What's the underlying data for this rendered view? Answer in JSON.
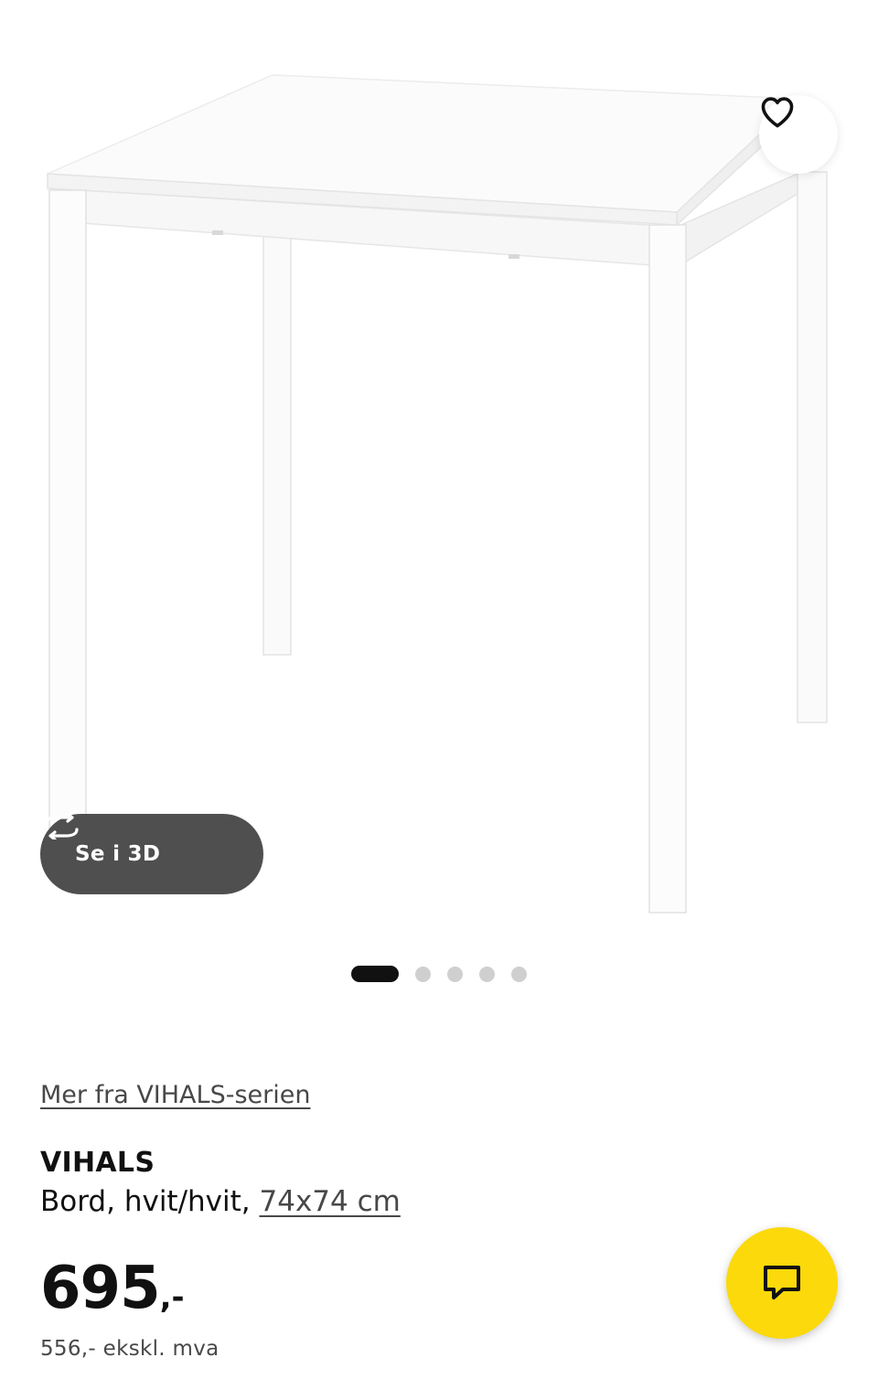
{
  "product_image": {
    "alt_name": "table-product-image"
  },
  "favorite": {
    "icon": "heart-icon"
  },
  "view_3d": {
    "label": "Se i 3D",
    "icon": "rotate-3d-icon"
  },
  "carousel": {
    "total": 5,
    "active_index": 0
  },
  "series_link": {
    "label": "Mer fra VIHALS-serien"
  },
  "product": {
    "name": "VIHALS",
    "description": "Bord, hvit/hvit, ",
    "size_link": "74x74 cm"
  },
  "price": {
    "integer": "695",
    "suffix": ",-",
    "ex_vat": "556,- ekskl. mva"
  },
  "chat": {
    "icon": "chat-bubble-icon"
  },
  "colors": {
    "chat_button": "#fcd90a",
    "view_3d_button": "#4f4f4f",
    "active_dot": "#111111",
    "inactive_dot": "#cfcfcf"
  }
}
